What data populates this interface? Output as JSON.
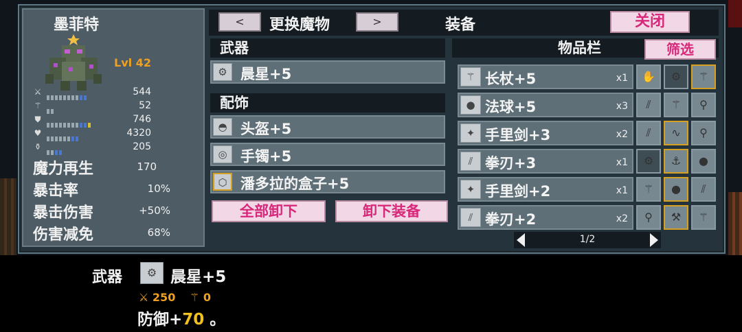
{
  "monster": {
    "name": "墨菲特",
    "level": "Lvl 42",
    "stats": [
      {
        "icon": "sword-icon",
        "value": "544"
      },
      {
        "icon": "staff-icon",
        "value": "52"
      },
      {
        "icon": "shield-icon",
        "value": "746"
      },
      {
        "icon": "heart-icon",
        "value": "4320"
      },
      {
        "icon": "potion-icon",
        "value": "205"
      }
    ],
    "extra_stats": [
      {
        "label": "魔力再生",
        "value": "170"
      },
      {
        "label": "暴击率",
        "value": "10%"
      },
      {
        "label": "暴击伤害",
        "value": "+50%"
      },
      {
        "label": "伤害减免",
        "value": "68%"
      }
    ]
  },
  "header": {
    "prev_label": "<",
    "next_label": ">",
    "switch_label": "更换魔物",
    "equip_label": "装备",
    "close_label": "关闭"
  },
  "equipment": {
    "weapon_header": "武器",
    "weapon": {
      "name": "晨星+5",
      "icon": "morning-star-icon"
    },
    "accessory_header": "配饰",
    "accessories": [
      {
        "name": "头盔+5",
        "icon": "helmet-icon"
      },
      {
        "name": "手镯+5",
        "icon": "bracelet-icon"
      },
      {
        "name": "潘多拉的盒子+5",
        "icon": "pandora-box-icon"
      }
    ],
    "unequip_all_label": "全部卸下",
    "unequip_label": "卸下装备"
  },
  "inventory": {
    "title": "物品栏",
    "filter_label": "筛选",
    "items": [
      {
        "name": "长杖+5",
        "qty": "x1",
        "icon": "staff-icon"
      },
      {
        "name": "法球+5",
        "qty": "x3",
        "icon": "orb-icon"
      },
      {
        "name": "手里剑+3",
        "qty": "x2",
        "icon": "shuriken-icon"
      },
      {
        "name": "拳刃+3",
        "qty": "x1",
        "icon": "claw-icon"
      },
      {
        "name": "手里剑+2",
        "qty": "x1",
        "icon": "shuriken-icon"
      },
      {
        "name": "拳刃+2",
        "qty": "x2",
        "icon": "claw-icon"
      }
    ],
    "grid": [
      [
        {
          "icon": "glove-icon",
          "style": ""
        },
        {
          "icon": "morning-star-icon",
          "style": "dark"
        },
        {
          "icon": "staff-icon",
          "style": "gold"
        }
      ],
      [
        {
          "icon": "claw-icon",
          "style": ""
        },
        {
          "icon": "staff-icon",
          "style": ""
        },
        {
          "icon": "wand-icon",
          "style": ""
        }
      ],
      [
        {
          "icon": "claw-icon",
          "style": ""
        },
        {
          "icon": "whip-icon",
          "style": "gold"
        },
        {
          "icon": "wand-icon",
          "style": ""
        }
      ],
      [
        {
          "icon": "morning-star-icon",
          "style": "dark"
        },
        {
          "icon": "hook-icon",
          "style": "gold"
        },
        {
          "icon": "orb-icon",
          "style": ""
        }
      ],
      [
        {
          "icon": "staff-icon",
          "style": ""
        },
        {
          "icon": "orb-icon",
          "style": "gold"
        },
        {
          "icon": "claw-icon",
          "style": ""
        }
      ],
      [
        {
          "icon": "wand-icon",
          "style": ""
        },
        {
          "icon": "hammer-icon",
          "style": "gold"
        },
        {
          "icon": "staff-icon",
          "style": ""
        }
      ]
    ],
    "page": "1/2"
  },
  "detail": {
    "slot_label": "武器",
    "item_name": "晨星+5",
    "attack": "250",
    "magic": "0",
    "defense_prefix": "防御+",
    "defense_value": "70",
    "defense_suffix": " 。"
  },
  "colors": {
    "accent_pink": "#d8287a",
    "gold": "#f0a020",
    "panel": "#24333c"
  }
}
